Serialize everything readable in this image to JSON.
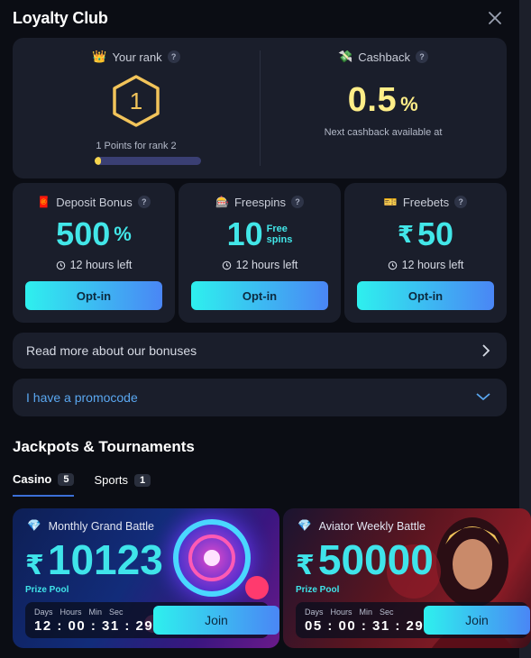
{
  "header": {
    "title": "Loyalty Club"
  },
  "rank": {
    "label": "Your rank",
    "value": "1",
    "subtitle": "1 Points for rank 2",
    "progress": 0.06
  },
  "cashback": {
    "label": "Cashback",
    "value": "0.5",
    "unit": "%",
    "subtitle": "Next cashback available at"
  },
  "bonuses": [
    {
      "label": "Deposit Bonus",
      "value": "500",
      "suffix": "%",
      "timer": "12 hours left",
      "button": "Opt-in"
    },
    {
      "label": "Freespins",
      "value": "10",
      "suffix_line1": "Free",
      "suffix_line2": "spins",
      "timer": "12 hours left",
      "button": "Opt-in"
    },
    {
      "label": "Freebets",
      "currency": "₹",
      "value": "50",
      "timer": "12 hours left",
      "button": "Opt-in"
    }
  ],
  "read_more": {
    "label": "Read more about our bonuses"
  },
  "promocode": {
    "label": "I have a promocode"
  },
  "jackpots": {
    "title": "Jackpots & Tournaments",
    "tabs": [
      {
        "label": "Casino",
        "count": "5",
        "active": true
      },
      {
        "label": "Sports",
        "count": "1",
        "active": false
      }
    ],
    "cards": [
      {
        "name": "Monthly Grand Battle",
        "currency": "₹",
        "amount": "10123",
        "pool_label": "Prize Pool",
        "labels": [
          "Days",
          "Hours",
          "Min",
          "Sec"
        ],
        "time": "12 : 00 : 31 : 29",
        "button": "Join"
      },
      {
        "name": "Aviator Weekly Battle",
        "currency": "₹",
        "amount": "50000",
        "pool_label": "Prize Pool",
        "labels": [
          "Days",
          "Hours",
          "Min",
          "Sec"
        ],
        "time": "05 : 00 : 31 : 29",
        "button": "Join"
      }
    ]
  },
  "colors": {
    "accent_cyan": "#42e6e8",
    "gold": "#f2c45a",
    "cashback_yellow": "#ffee88",
    "panel": "#1a1e2b",
    "background": "#0b0d14"
  },
  "icons": [
    "crown-icon",
    "cash-icon",
    "gift-icon",
    "freespins-icon",
    "ticket-icon",
    "clock-icon",
    "diamond-icon",
    "close-icon",
    "chevron-right-icon",
    "chevron-down-icon"
  ]
}
